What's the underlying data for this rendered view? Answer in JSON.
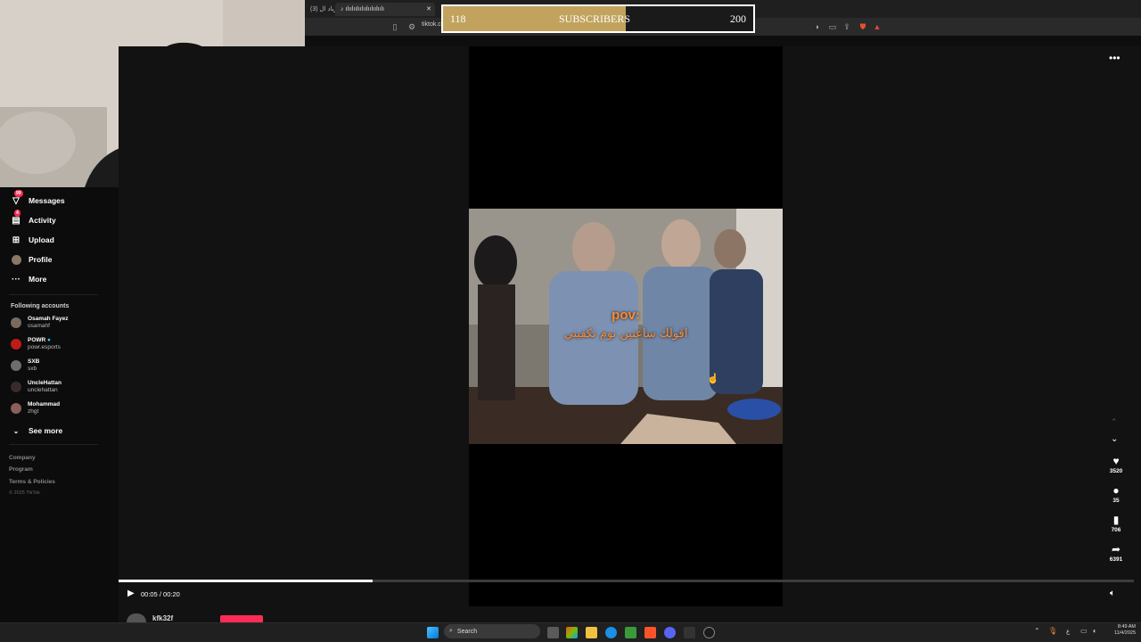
{
  "browser": {
    "tabs": [
      "(3) زياد ال",
      "ılıılıılıılıılıılıılıılı"
    ],
    "address": "tiktok.c",
    "new_tab": "+"
  },
  "overlay": {
    "current": "118",
    "label": "SUBSCRIBERS",
    "goal": "200",
    "progress": 0.59,
    "fill_color": "#c2a35e"
  },
  "sidebar": {
    "nav": [
      {
        "label": "Messages",
        "icon": "paper-plane-icon",
        "badge": "99"
      },
      {
        "label": "Activity",
        "icon": "inbox-icon",
        "badge": "4"
      },
      {
        "label": "Upload",
        "icon": "plus-square-icon"
      },
      {
        "label": "Profile",
        "icon": "avatar-icon"
      },
      {
        "label": "More",
        "icon": "ellipsis-icon"
      }
    ],
    "following_title": "Following accounts",
    "accounts": [
      {
        "name": "Osamah Fayez",
        "handle": "osamahf"
      },
      {
        "name": "POWR",
        "handle": "powr.esports"
      },
      {
        "name": "SXB",
        "handle": "sxb"
      },
      {
        "name": "UncleHattan",
        "handle": "unclehattan"
      },
      {
        "name": "Mohammad",
        "handle": "zhgt"
      }
    ],
    "see_more": "See more",
    "footer": [
      "Company",
      "Program",
      "Terms & Policies"
    ],
    "copyright": "© 2025 TikTok"
  },
  "video": {
    "caption_title": "pov:",
    "caption_text": "اقولك ساعتين نوم تكفيني",
    "time": "00:05 / 00:20",
    "progress": 0.25,
    "author": "kfk32f"
  },
  "actions": {
    "likes": "3520",
    "comments": "35",
    "saves": "706",
    "shares": "6391"
  },
  "taskbar": {
    "search": "Search",
    "time": "8:49 AM",
    "date": "11/4/2025",
    "lang": "ع"
  }
}
